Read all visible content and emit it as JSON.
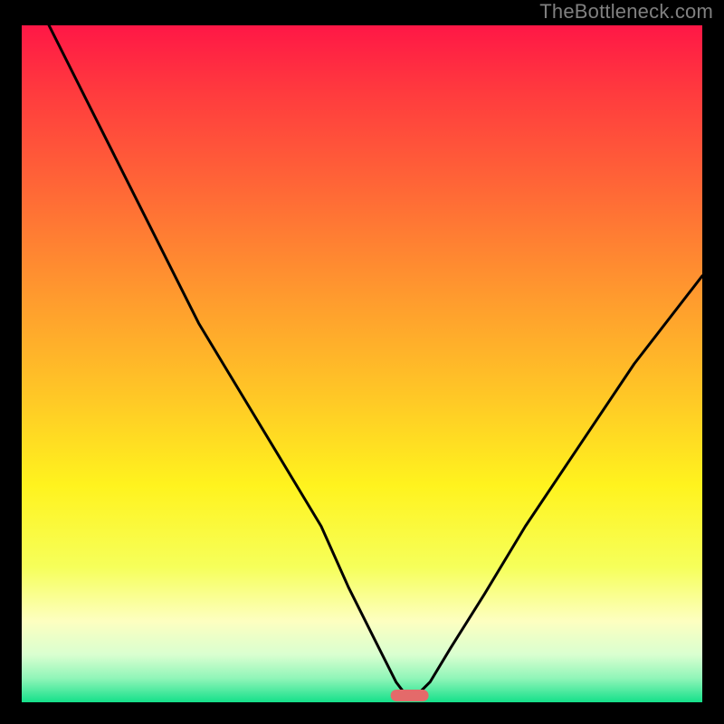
{
  "watermark": "TheBottleneck.com",
  "colors": {
    "background": "#000000",
    "watermark": "#808080",
    "curve": "#000000",
    "marker_fill": "#e46a6a",
    "gradient_stops": [
      {
        "offset": 0.0,
        "color": "#ff1746"
      },
      {
        "offset": 0.1,
        "color": "#ff3b3e"
      },
      {
        "offset": 0.25,
        "color": "#ff6a36"
      },
      {
        "offset": 0.4,
        "color": "#ff9a2e"
      },
      {
        "offset": 0.55,
        "color": "#ffc826"
      },
      {
        "offset": 0.68,
        "color": "#fff31e"
      },
      {
        "offset": 0.8,
        "color": "#f6ff5a"
      },
      {
        "offset": 0.88,
        "color": "#fdffc0"
      },
      {
        "offset": 0.93,
        "color": "#d9ffd0"
      },
      {
        "offset": 0.965,
        "color": "#8ff5b8"
      },
      {
        "offset": 1.0,
        "color": "#15e08a"
      }
    ]
  },
  "chart_data": {
    "type": "line",
    "title": "",
    "xlabel": "",
    "ylabel": "",
    "xlim": [
      0,
      100
    ],
    "ylim": [
      0,
      100
    ],
    "legend": false,
    "grid": false,
    "series": [
      {
        "name": "bottleneck-curve",
        "x": [
          4,
          10,
          18,
          26,
          32,
          38,
          44,
          48,
          52,
          55,
          56.5,
          58,
          60,
          63,
          68,
          74,
          82,
          90,
          100
        ],
        "y": [
          100,
          88,
          72,
          56,
          46,
          36,
          26,
          17,
          9,
          3,
          1,
          1,
          3,
          8,
          16,
          26,
          38,
          50,
          63
        ]
      }
    ],
    "marker": {
      "x": 57,
      "y": 1,
      "shape": "pill"
    }
  }
}
